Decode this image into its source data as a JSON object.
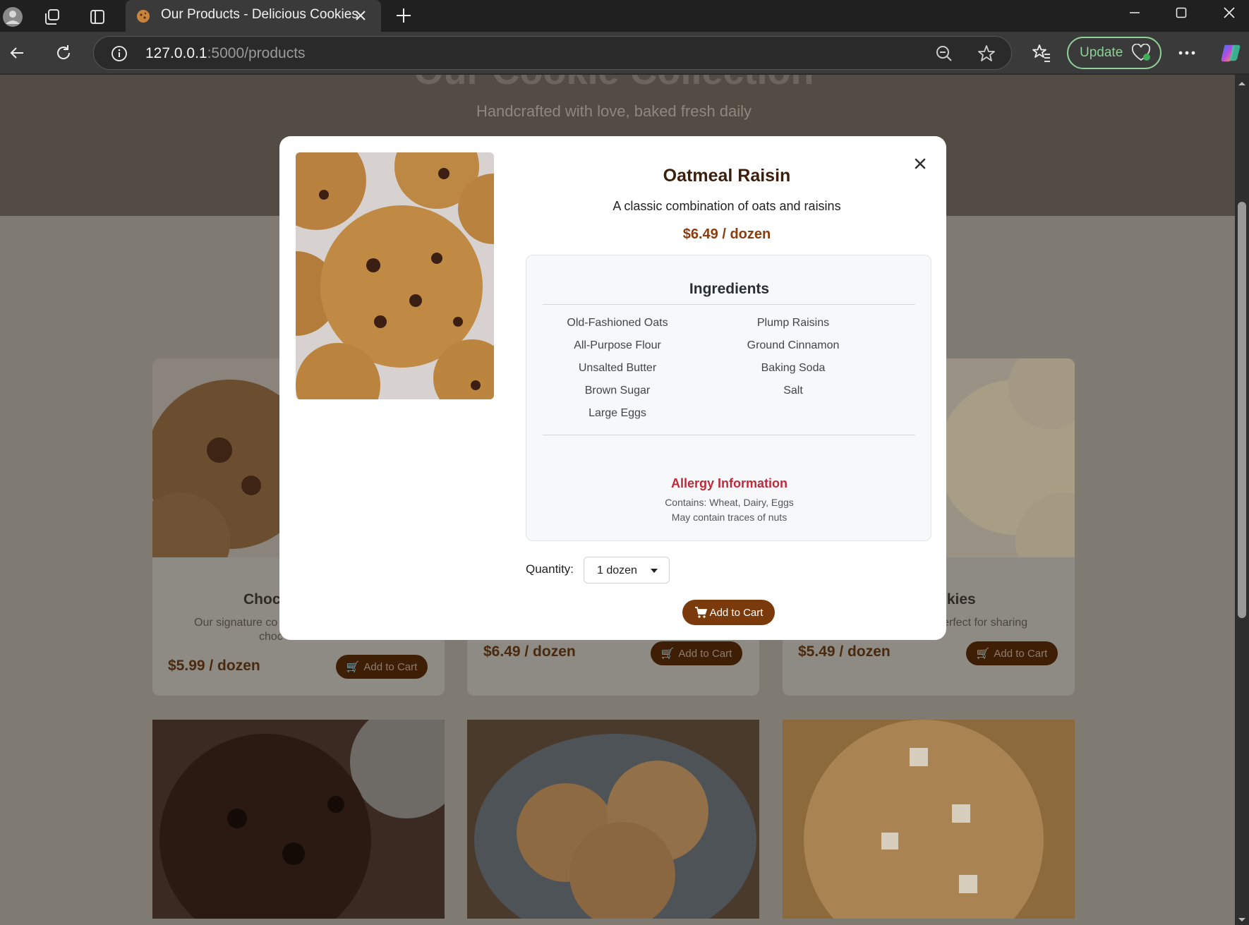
{
  "browser": {
    "tab_title": "Our Products - Delicious Cookies",
    "url_host": "127.0.0.1",
    "url_rest": ":5000/products",
    "update_label": "Update"
  },
  "hero": {
    "title": "Our Cookie Collection",
    "subtitle": "Handcrafted with love, baked fresh daily"
  },
  "cards": [
    {
      "title_visible": "Choc",
      "desc_line1": "Our signature co",
      "desc_line2": "choc",
      "price": "$5.99 / dozen",
      "button": "Add to Cart"
    },
    {
      "price": "$6.49 / dozen",
      "button": "Add to Cart"
    },
    {
      "title_visible": "okies",
      "desc_visible": "erfect for sharing",
      "price": "$5.49 / dozen",
      "button": "Add to Cart"
    }
  ],
  "modal": {
    "title": "Oatmeal Raisin",
    "description": "A classic combination of oats and raisins",
    "price": "$6.49 / dozen",
    "ingredients_title": "Ingredients",
    "ingredients": [
      "Old-Fashioned Oats",
      "Plump Raisins",
      "All-Purpose Flour",
      "Ground Cinnamon",
      "Unsalted Butter",
      "Baking Soda",
      "Brown Sugar",
      "Salt",
      "Large Eggs"
    ],
    "allergy_title": "Allergy Information",
    "allergy_contains": "Contains: Wheat, Dairy, Eggs",
    "allergy_traces": "May contain traces of nuts",
    "quantity_label": "Quantity:",
    "quantity_value": "1 dozen",
    "add_button": "Add to Cart"
  },
  "colors": {
    "accent_brown": "#7a3a0b",
    "price_brown": "#8a3d0e",
    "allergy_red": "#c0293a"
  }
}
